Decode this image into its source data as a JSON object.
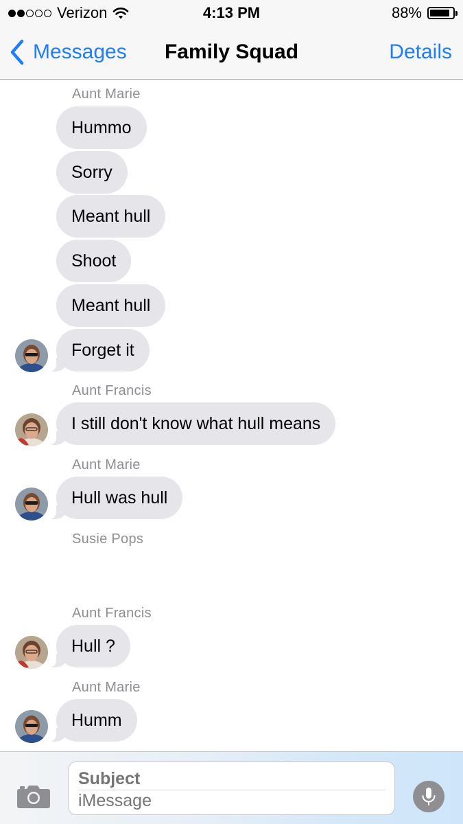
{
  "status_bar": {
    "carrier": "Verizon",
    "signal_bars": 2,
    "signal_total": 5,
    "time": "4:13 PM",
    "battery": "88%",
    "battery_level": 0.88
  },
  "nav": {
    "back_label": "Messages",
    "title": "Family Squad",
    "details_label": "Details"
  },
  "conversation": {
    "senders": [
      "Aunt Marie",
      "Aunt Francis",
      "Aunt Marie",
      "Susie Pops",
      "Aunt Francis",
      "Aunt Marie"
    ],
    "messages": [
      "Hummo",
      "Sorry",
      "Meant hull",
      "Shoot",
      "Meant hull",
      "Forget it",
      "I still don't know what hull means",
      "Hull was hull",
      "Hull ?",
      "Humm"
    ]
  },
  "compose": {
    "subject_placeholder": "Subject",
    "message_placeholder": "iMessage"
  },
  "colors": {
    "accent": "#1f7ef7",
    "incoming_bubble": "#e5e5ea",
    "sender_label": "#8e8e93"
  },
  "icons": {
    "back": "chevron-left-icon",
    "wifi": "wifi-icon",
    "battery": "battery-icon",
    "camera": "camera-icon",
    "mic": "microphone-icon"
  }
}
